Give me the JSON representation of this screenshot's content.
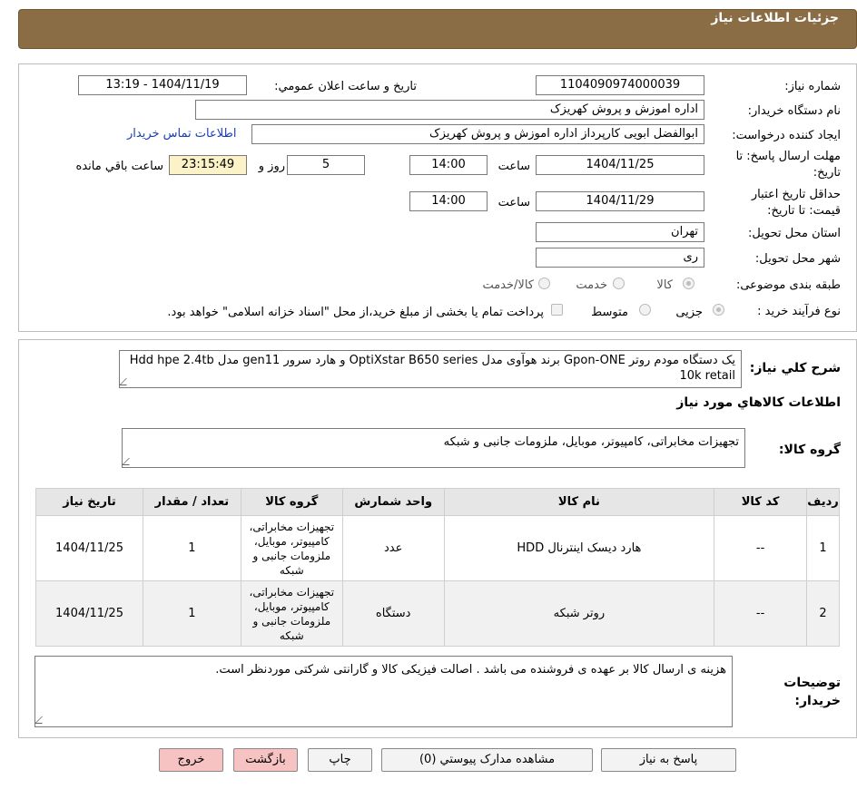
{
  "header": {
    "title": "جزئیات اطلاعات نیاز"
  },
  "fields": {
    "need_number_label": "شماره نیاز:",
    "need_number": "1104090974000039",
    "announce_label": "تاریخ و ساعت اعلان عمومي:",
    "announce_value": "1404/11/19 - 13:19",
    "buyer_org_label": "نام دستگاه خريدار:",
    "buyer_org": "اداره اموزش و پروش کهریزک",
    "creator_label": "ايجاد کننده درخواست:",
    "creator": "ابوالفضل ابویی کارپرداز اداره اموزش و پروش کهریزک",
    "contact_link": "اطلاعات تماس خريدار",
    "deadline_label_1": "مهلت ارسال پاسخ: تا",
    "deadline_label_2": "تاريخ:",
    "deadline_date": "1404/11/25",
    "time_label": "ساعت",
    "deadline_time": "14:00",
    "days_value": "5",
    "days_label": "روز و",
    "remaining_time": "23:15:49",
    "remaining_label": "ساعت باقي مانده",
    "validity_label_1": "حداقل تاريخ اعتبار",
    "validity_label_2": "قيمت: تا تاريخ:",
    "validity_date": "1404/11/29",
    "validity_time": "14:00",
    "province_label": "استان محل تحويل:",
    "province": "تهران",
    "city_label": "شهر محل تحويل:",
    "city": "ری",
    "category_label": "طبقه بندی موضوعی:",
    "category_options": [
      "کالا",
      "خدمت",
      "کالا/خدمت"
    ],
    "process_label": "نوع فرآيند خريد :",
    "process_options": [
      "جزیی",
      "متوسط"
    ],
    "process_note": "پرداخت تمام يا بخشی از مبلغ خريد،از محل \"اسناد خزانه اسلامی\" خواهد بود."
  },
  "summary": {
    "label": "شرح کلي نياز:",
    "text": "یک دستگاه مودم روتر Gpon-ONE برند هوآوی مدل OptiXstar B650 series و هارد سرور gen11 مدل Hdd hpe 2.4tb 10k retail"
  },
  "goods": {
    "section_title": "اطلاعات کالاهاي مورد نياز",
    "group_label": "گروه کالا:",
    "group_value": "تجهیزات مخابراتی، کامپیوتر، موبایل، ملزومات جانبی و شبکه",
    "columns": [
      "رديف",
      "کد کالا",
      "نام کالا",
      "واحد شمارش",
      "گروه کالا",
      "تعداد / مقدار",
      "تاريخ نياز"
    ],
    "rows": [
      {
        "row": "1",
        "code": "--",
        "name": "هارد دیسک اینترنال HDD",
        "unit": "عدد",
        "group": "تجهیزات مخابراتی، کامپیوتر، موبایل، ملزومات جانبی و شبکه",
        "qty": "1",
        "date": "1404/11/25"
      },
      {
        "row": "2",
        "code": "--",
        "name": "روتر شبکه",
        "unit": "دستگاه",
        "group": "تجهیزات مخابراتی، کامپیوتر، موبایل، ملزومات جانبی و شبکه",
        "qty": "1",
        "date": "1404/11/25"
      }
    ]
  },
  "buyer_notes": {
    "label_1": "توضيحات",
    "label_2": "خريدار:",
    "text": "هزینه ی ارسال کالا بر عهده ی فروشنده می باشد . اصالت فیزیکی کالا و گارانتی شرکتی موردنظر است."
  },
  "buttons": {
    "respond": "پاسخ به نياز",
    "attachments": "مشاهده مدارک پيوستي (0)",
    "print": "چاپ",
    "back": "بازگشت",
    "exit": "خروج"
  },
  "colors": {
    "header_bg": "#8b6d45",
    "link": "#1a3eb5",
    "remaining_bg": "#fbf3c7",
    "exit_bg": "#f7c2c2"
  }
}
